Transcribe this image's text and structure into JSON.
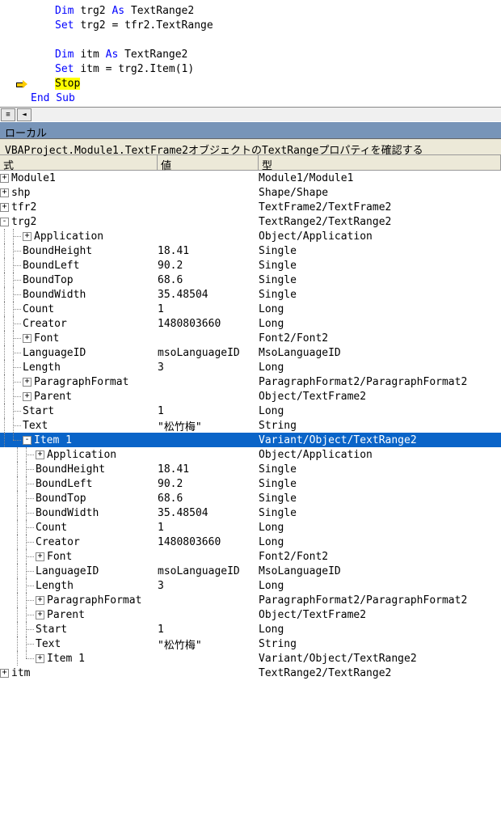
{
  "code": {
    "lines": [
      {
        "tokens": [
          {
            "text": "Dim ",
            "cls": "kw-dim"
          },
          {
            "text": "trg2 ",
            "cls": "code-text"
          },
          {
            "text": "As ",
            "cls": "kw-as"
          },
          {
            "text": "TextRange2",
            "cls": "code-text"
          }
        ]
      },
      {
        "tokens": [
          {
            "text": "Set ",
            "cls": "kw-set"
          },
          {
            "text": "trg2 = tfr2.TextRange",
            "cls": "code-text"
          }
        ]
      },
      {
        "tokens": []
      },
      {
        "tokens": [
          {
            "text": "Dim ",
            "cls": "kw-dim"
          },
          {
            "text": "itm ",
            "cls": "code-text"
          },
          {
            "text": "As ",
            "cls": "kw-as"
          },
          {
            "text": "TextRange2",
            "cls": "code-text"
          }
        ]
      },
      {
        "tokens": [
          {
            "text": "Set ",
            "cls": "kw-set"
          },
          {
            "text": "itm = trg2.Item(1)",
            "cls": "code-text"
          }
        ]
      },
      {
        "tokens": [
          {
            "text": "Stop",
            "cls": "kw-stop"
          }
        ],
        "arrow": true
      },
      {
        "tokens": [
          {
            "text": "End Sub",
            "cls": "kw-endsub"
          }
        ],
        "noindent": true
      }
    ]
  },
  "panel": {
    "title": "ローカル",
    "context": "VBAProject.Module1.TextFrame2オブジェクトのTextRangeプロパティを確認する"
  },
  "headers": {
    "expr": "式",
    "val": "値",
    "type": "型"
  },
  "rows": [
    {
      "depth": 0,
      "box": "+",
      "name": "Module1",
      "val": "",
      "type": "Module1/Module1"
    },
    {
      "depth": 0,
      "box": "+",
      "name": "shp",
      "val": "",
      "type": "Shape/Shape"
    },
    {
      "depth": 0,
      "box": "+",
      "name": "tfr2",
      "val": "",
      "type": "TextFrame2/TextFrame2"
    },
    {
      "depth": 0,
      "box": "-",
      "name": "trg2",
      "val": "",
      "type": "TextRange2/TextRange2"
    },
    {
      "depth": 1,
      "box": "+",
      "name": "Application",
      "val": "",
      "type": "Object/Application",
      "cont": true
    },
    {
      "depth": 1,
      "box": "",
      "name": "BoundHeight",
      "val": "18.41",
      "type": "Single",
      "cont": true
    },
    {
      "depth": 1,
      "box": "",
      "name": "BoundLeft",
      "val": "90.2",
      "type": "Single",
      "cont": true
    },
    {
      "depth": 1,
      "box": "",
      "name": "BoundTop",
      "val": "68.6",
      "type": "Single",
      "cont": true
    },
    {
      "depth": 1,
      "box": "",
      "name": "BoundWidth",
      "val": "35.48504",
      "type": "Single",
      "cont": true
    },
    {
      "depth": 1,
      "box": "",
      "name": "Count",
      "val": "1",
      "type": "Long",
      "cont": true
    },
    {
      "depth": 1,
      "box": "",
      "name": "Creator",
      "val": "1480803660",
      "type": "Long",
      "cont": true
    },
    {
      "depth": 1,
      "box": "+",
      "name": "Font",
      "val": "",
      "type": "Font2/Font2",
      "cont": true
    },
    {
      "depth": 1,
      "box": "",
      "name": "LanguageID",
      "val": "msoLanguageID",
      "type": "MsoLanguageID",
      "cont": true
    },
    {
      "depth": 1,
      "box": "",
      "name": "Length",
      "val": "3",
      "type": "Long",
      "cont": true
    },
    {
      "depth": 1,
      "box": "+",
      "name": "ParagraphFormat",
      "val": "",
      "type": "ParagraphFormat2/ParagraphFormat2",
      "cont": true
    },
    {
      "depth": 1,
      "box": "+",
      "name": "Parent",
      "val": "",
      "type": "Object/TextFrame2",
      "cont": true
    },
    {
      "depth": 1,
      "box": "",
      "name": "Start",
      "val": "1",
      "type": "Long",
      "cont": true
    },
    {
      "depth": 1,
      "box": "",
      "name": "Text",
      "val": "\"松竹梅\"",
      "type": "String",
      "cont": true
    },
    {
      "depth": 1,
      "box": "-",
      "name": "Item 1",
      "val": "",
      "type": "Variant/Object/TextRange2",
      "selected": true,
      "cont": false
    },
    {
      "depth": 2,
      "box": "+",
      "name": "Application",
      "val": "",
      "type": "Object/Application",
      "cont": true
    },
    {
      "depth": 2,
      "box": "",
      "name": "BoundHeight",
      "val": "18.41",
      "type": "Single",
      "cont": true
    },
    {
      "depth": 2,
      "box": "",
      "name": "BoundLeft",
      "val": "90.2",
      "type": "Single",
      "cont": true
    },
    {
      "depth": 2,
      "box": "",
      "name": "BoundTop",
      "val": "68.6",
      "type": "Single",
      "cont": true
    },
    {
      "depth": 2,
      "box": "",
      "name": "BoundWidth",
      "val": "35.48504",
      "type": "Single",
      "cont": true
    },
    {
      "depth": 2,
      "box": "",
      "name": "Count",
      "val": "1",
      "type": "Long",
      "cont": true
    },
    {
      "depth": 2,
      "box": "",
      "name": "Creator",
      "val": "1480803660",
      "type": "Long",
      "cont": true
    },
    {
      "depth": 2,
      "box": "+",
      "name": "Font",
      "val": "",
      "type": "Font2/Font2",
      "cont": true
    },
    {
      "depth": 2,
      "box": "",
      "name": "LanguageID",
      "val": "msoLanguageID",
      "type": "MsoLanguageID",
      "cont": true
    },
    {
      "depth": 2,
      "box": "",
      "name": "Length",
      "val": "3",
      "type": "Long",
      "cont": true
    },
    {
      "depth": 2,
      "box": "+",
      "name": "ParagraphFormat",
      "val": "",
      "type": "ParagraphFormat2/ParagraphFormat2",
      "cont": true
    },
    {
      "depth": 2,
      "box": "+",
      "name": "Parent",
      "val": "",
      "type": "Object/TextFrame2",
      "cont": true
    },
    {
      "depth": 2,
      "box": "",
      "name": "Start",
      "val": "1",
      "type": "Long",
      "cont": true
    },
    {
      "depth": 2,
      "box": "",
      "name": "Text",
      "val": "\"松竹梅\"",
      "type": "String",
      "cont": true
    },
    {
      "depth": 2,
      "box": "+",
      "name": "Item 1",
      "val": "",
      "type": "Variant/Object/TextRange2",
      "cont": false
    },
    {
      "depth": 0,
      "box": "+",
      "name": "itm",
      "val": "",
      "type": "TextRange2/TextRange2"
    }
  ]
}
